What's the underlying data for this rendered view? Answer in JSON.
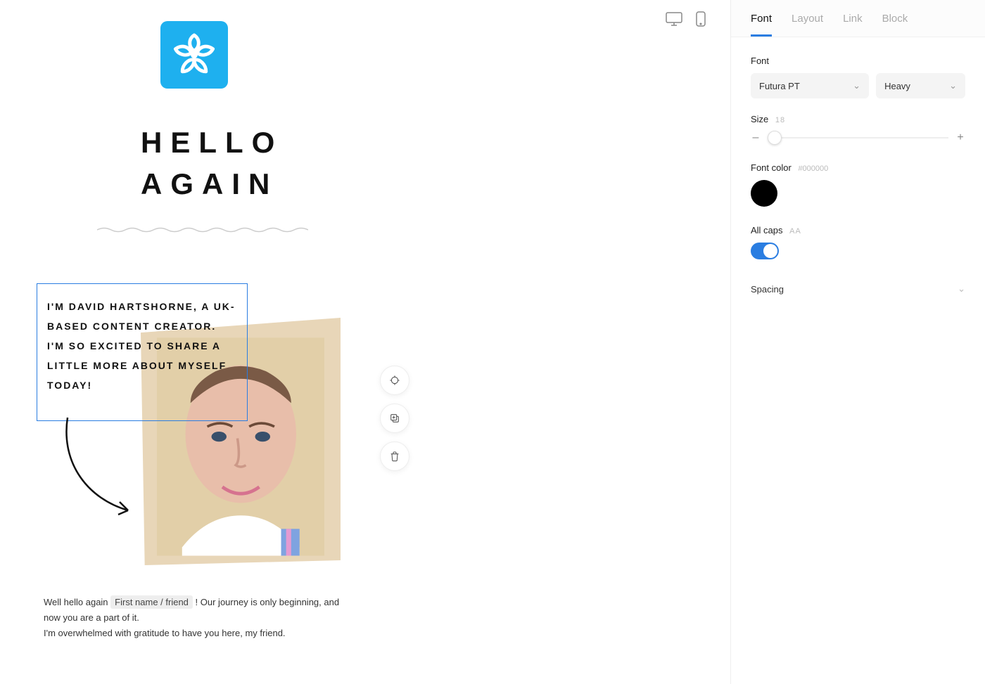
{
  "canvas": {
    "headline_line1": "Hello",
    "headline_line2": "Again",
    "selected_text": "I'm David Hartshorne, a UK-based content creator. I'm so excited to share a little more about myself today!",
    "body_before_tag": "Well hello again ",
    "merge_tag": "First name / friend",
    "body_after_tag": " ! Our journey is only beginning, and now you are a part of it.",
    "body_line2": "I'm overwhelmed with gratitude to have you here, my friend.",
    "logo_icon": "flower-icon",
    "photo_alt": "portrait-photo"
  },
  "float_tools": {
    "settings": "settings-icon",
    "duplicate": "duplicate-icon",
    "delete": "trash-icon"
  },
  "devices": {
    "desktop": "desktop-icon",
    "mobile": "mobile-icon"
  },
  "panel": {
    "tabs": [
      "Font",
      "Layout",
      "Link",
      "Block"
    ],
    "active_tab": "Font",
    "font_label": "Font",
    "font_family": "Futura PT",
    "font_weight": "Heavy",
    "size_label": "Size",
    "size_value": "18",
    "size_minus": "–",
    "size_plus": "+",
    "color_label": "Font color",
    "color_hex": "#000000",
    "color_value": "#000000",
    "caps_label": "All caps",
    "caps_hint": "AA",
    "caps_on": true,
    "spacing_label": "Spacing"
  }
}
